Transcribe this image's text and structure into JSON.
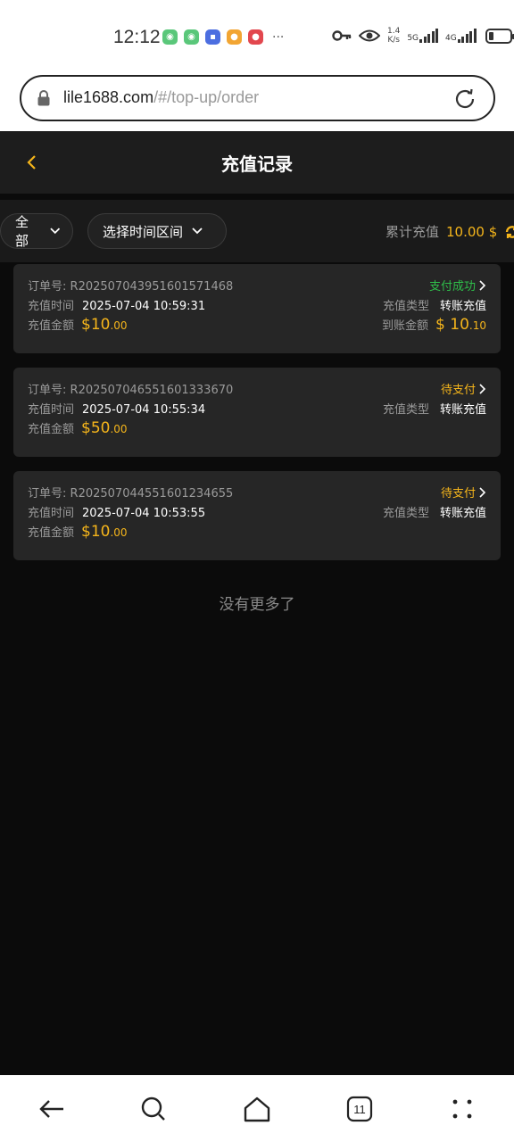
{
  "status_bar": {
    "time": "12:12",
    "more": "···",
    "speed_value": "1.4",
    "speed_unit": "K/s",
    "net1": "5G",
    "net2": "4G",
    "app_icons": [
      {
        "name": "android-app-icon",
        "color": "#5ac77a"
      },
      {
        "name": "android-app-icon",
        "color": "#5ac77a"
      },
      {
        "name": "photo-app-icon",
        "color": "#4c6ee0"
      },
      {
        "name": "chat-app-icon",
        "color": "#f2a533"
      },
      {
        "name": "weibo-app-icon",
        "color": "#e2474e"
      }
    ]
  },
  "browser": {
    "url_host": "lile1688.com",
    "url_path": "/#/top-up/order"
  },
  "header": {
    "title": "充值记录"
  },
  "filters": {
    "category": "全部",
    "date_range": "选择时间区间",
    "total_label": "累计充值",
    "total_value": "10.00 $"
  },
  "orders": [
    {
      "order_label": "订单号:",
      "order_no": "R2025070439516015714​68",
      "status": "支付成功",
      "time_label": "充值时间",
      "time": "2025-07-04 10:59:31",
      "type_label": "充值类型",
      "type": "转账充值",
      "amount_label": "充值金额",
      "amount_int": "$10",
      "amount_dec": ".00",
      "received_label": "到账金额",
      "received_int": "$ 10",
      "received_dec": ".10"
    },
    {
      "order_label": "订单号:",
      "order_no": "R202507046551601333670",
      "status": "待支付",
      "time_label": "充值时间",
      "time": "2025-07-04 10:55:34",
      "type_label": "充值类型",
      "type": "转账充值",
      "amount_label": "充值金额",
      "amount_int": "$50",
      "amount_dec": ".00"
    },
    {
      "order_label": "订单号:",
      "order_no": "R202507044551601234655",
      "status": "待支付",
      "time_label": "充值时间",
      "time": "2025-07-04 10:53:55",
      "type_label": "充值类型",
      "type": "转账充值",
      "amount_label": "充值金额",
      "amount_int": "$10",
      "amount_dec": ".00"
    }
  ],
  "footer_text": "没有更多了",
  "bottom_nav": {
    "tabs_count": "11"
  },
  "colors": {
    "accent": "#f5b51b",
    "success": "#2fbf4a",
    "background": "#0b0b0b",
    "card": "#262626"
  }
}
